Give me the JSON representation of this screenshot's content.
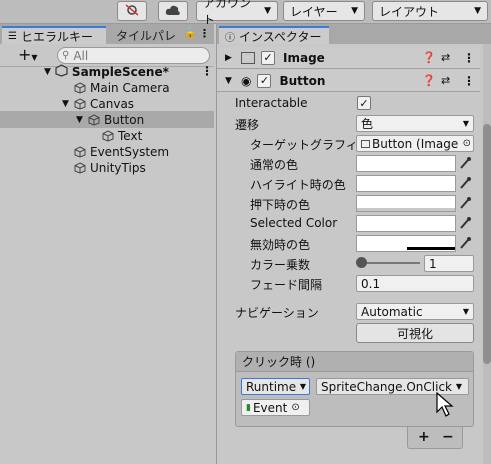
{
  "toolbar": {
    "account": "アカウント",
    "layers": "レイヤー",
    "layout": "レイアウト"
  },
  "hierarchy": {
    "tab_label": "ヒエラルキー",
    "tab2_label": "タイルパレ",
    "search_placeholder": "All",
    "add_label": "+",
    "scene": "SampleScene*",
    "items": [
      "Main Camera",
      "Canvas",
      "Button",
      "Text",
      "EventSystem",
      "UnityTips"
    ]
  },
  "inspector": {
    "tab_label": "インスペクター",
    "comp1": "Image",
    "comp2": "Button",
    "interactable_label": "Interactable",
    "transition_label": "遷移",
    "transition_value": "色",
    "target_label": "ターゲットグラフィックス",
    "target_value": "Button (Image",
    "normal_label": "通常の色",
    "highlight_label": "ハイライト時の色",
    "pressed_label": "押下時の色",
    "selected_label": "Selected Color",
    "disabled_label": "無効時の色",
    "multiplier_label": "カラー乗数",
    "multiplier_value": "1",
    "fade_label": "フェード間隔",
    "fade_value": "0.1",
    "nav_label": "ナビゲーション",
    "nav_value": "Automatic",
    "visualize_label": "可視化",
    "onclick_label": "クリック時 ()",
    "runtime_value": "Runtime",
    "function_value": "SpriteChange.OnClick",
    "object_value": "Event",
    "plus_label": "+",
    "minus_label": "−"
  },
  "colors": {
    "accent": "#3a7ad9",
    "selected_row": "#a9a9a9"
  }
}
